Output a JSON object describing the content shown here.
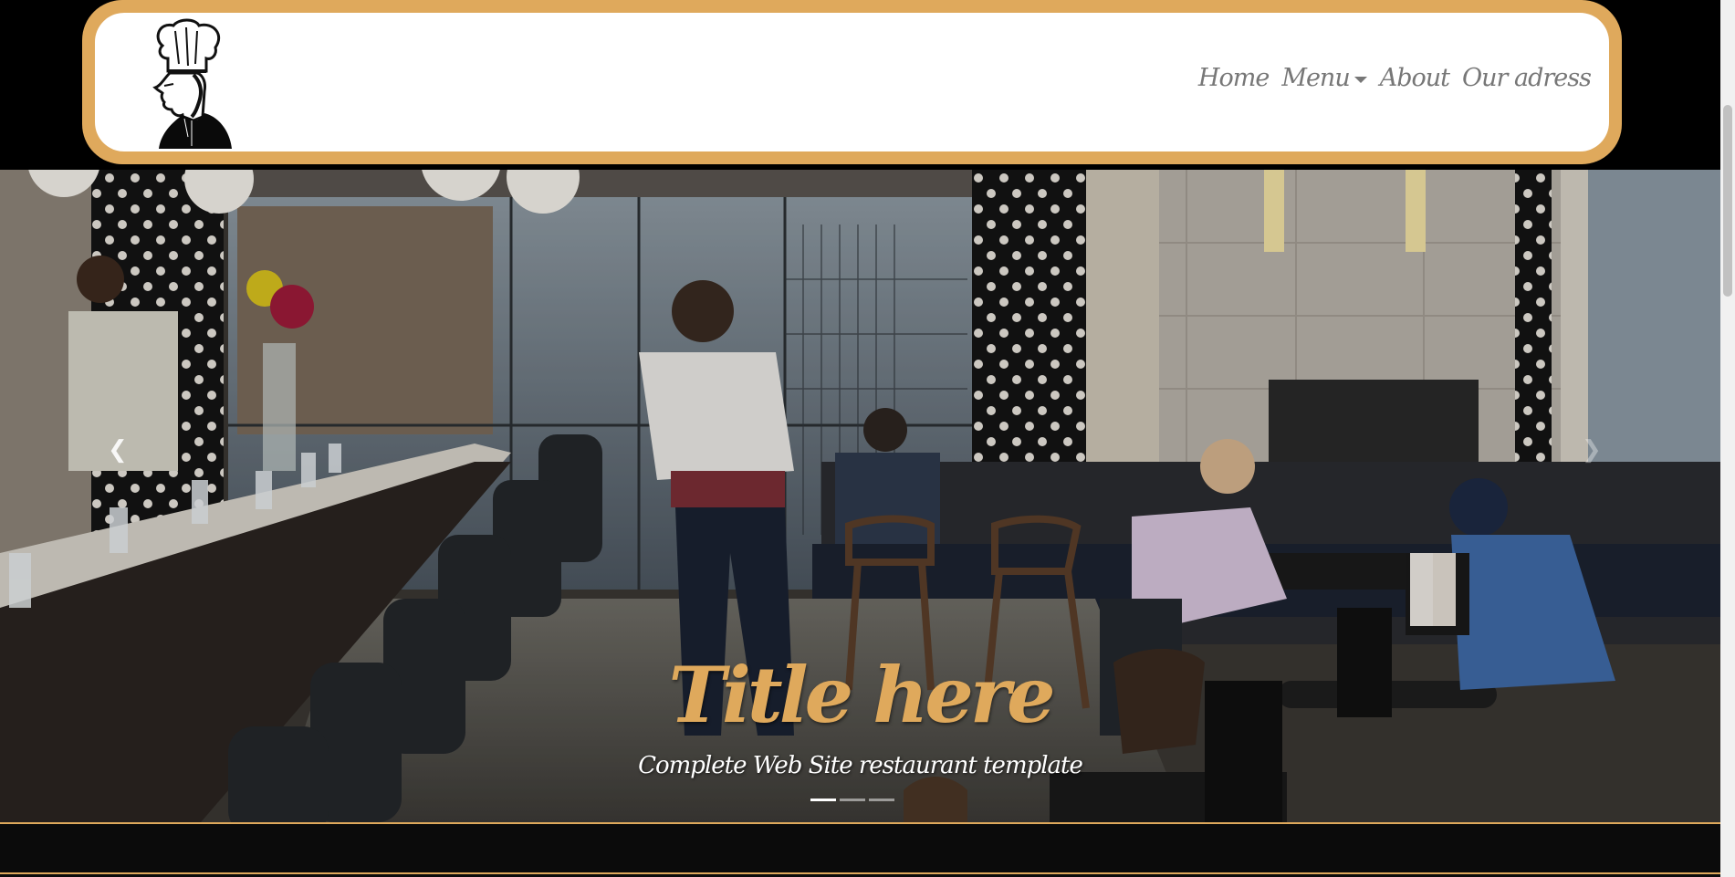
{
  "nav": {
    "logo_icon": "chef-head-icon",
    "links": [
      {
        "label": "Home"
      },
      {
        "label": "Menu",
        "dropdown": true
      },
      {
        "label": "About"
      },
      {
        "label": "Our adress"
      }
    ]
  },
  "hero": {
    "title": "Title here",
    "subtitle": "Complete Web Site restaurant template",
    "prev_icon": "chevron-left-icon",
    "next_icon": "chevron-right-icon",
    "slides_count": 3,
    "active_slide": 1
  },
  "colors": {
    "accent": "#dfa95c",
    "background": "#000000",
    "nav_text": "#777777",
    "caption_text": "#ffffff"
  }
}
